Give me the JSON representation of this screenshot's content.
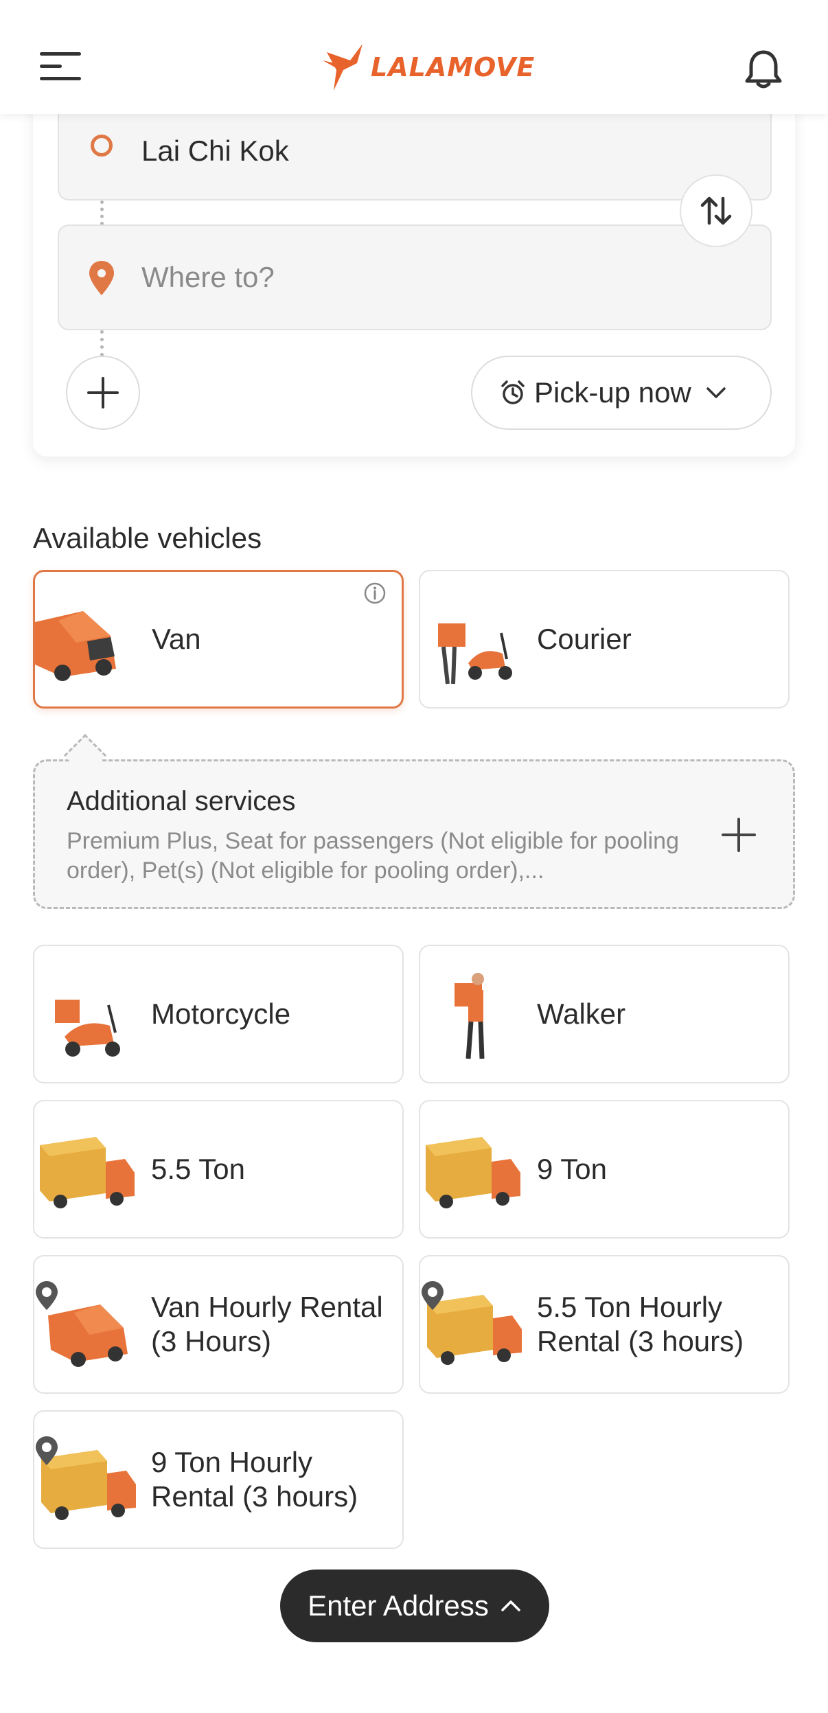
{
  "header": {
    "brand": "LALAMOVE",
    "icons": {
      "menu": "hamburger-menu-icon",
      "notifications": "bell-icon",
      "logo_mark": "bird-logo-icon"
    }
  },
  "route": {
    "pickup_value": "Lai Chi Kok",
    "dropoff_placeholder": "Where to?",
    "pickup_time_label": "Pick-up now"
  },
  "vehicles_section": {
    "title": "Available vehicles",
    "vehicles": [
      {
        "name": "Van",
        "selected": true,
        "icon": "van-icon"
      },
      {
        "name": "Courier",
        "selected": false,
        "icon": "courier-scooter-icon"
      },
      {
        "name": "Motorcycle",
        "selected": false,
        "icon": "motorcycle-icon"
      },
      {
        "name": "Walker",
        "selected": false,
        "icon": "walker-icon"
      },
      {
        "name": "5.5 Ton",
        "selected": false,
        "icon": "truck-icon"
      },
      {
        "name": "9 Ton",
        "selected": false,
        "icon": "truck-icon"
      },
      {
        "name": "Van Hourly Rental (3 Hours)",
        "selected": false,
        "icon": "van-hourly-icon"
      },
      {
        "name": "5.5 Ton Hourly Rental (3 hours)",
        "selected": false,
        "icon": "truck-hourly-icon"
      },
      {
        "name": "9 Ton Hourly Rental (3 hours)",
        "selected": false,
        "icon": "truck-hourly-icon"
      }
    ]
  },
  "additional_services": {
    "title": "Additional services",
    "description": "Premium Plus, Seat for passengers (Not eligible for pooling order), Pet(s) (Not eligible for pooling order),..."
  },
  "bottom": {
    "enter_address_label": "Enter Address"
  },
  "colors": {
    "accent": "#e07845",
    "brand": "#e8622c",
    "dark_pill": "#2b2b2b",
    "van_orange": "#e8733a",
    "truck_yellow": "#e6ac3f"
  }
}
